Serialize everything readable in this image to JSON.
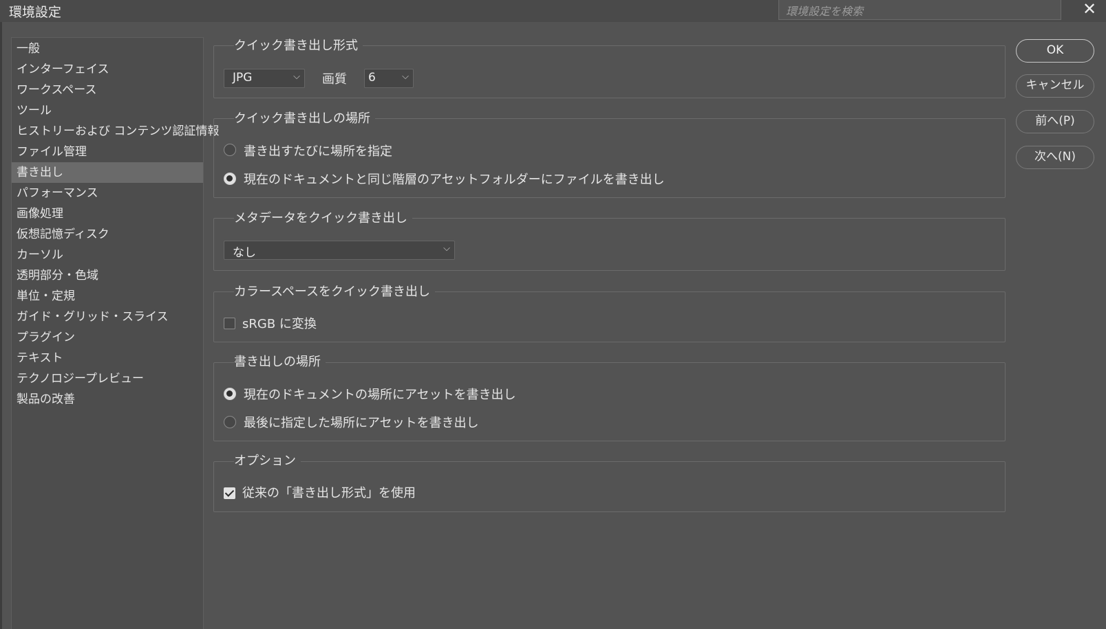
{
  "window": {
    "title": "環境設定",
    "close_glyph": "✕"
  },
  "search": {
    "placeholder": "環境設定を検索"
  },
  "sidebar": {
    "items": [
      {
        "label": "一般"
      },
      {
        "label": "インターフェイス"
      },
      {
        "label": "ワークスペース"
      },
      {
        "label": "ツール"
      },
      {
        "label": "ヒストリーおよび コンテンツ認証情報"
      },
      {
        "label": "ファイル管理"
      },
      {
        "label": "書き出し",
        "active": true
      },
      {
        "label": "パフォーマンス"
      },
      {
        "label": "画像処理"
      },
      {
        "label": "仮想記憶ディスク"
      },
      {
        "label": "カーソル"
      },
      {
        "label": "透明部分・色域"
      },
      {
        "label": "単位・定規"
      },
      {
        "label": "ガイド・グリッド・スライス"
      },
      {
        "label": "プラグイン"
      },
      {
        "label": "テキスト"
      },
      {
        "label": "テクノロジープレビュー"
      },
      {
        "label": "製品の改善"
      }
    ]
  },
  "quick_export_format": {
    "title": "クイック書き出し形式",
    "format_value": "JPG",
    "quality_label": "画質",
    "quality_value": "6"
  },
  "quick_export_location": {
    "title": "クイック書き出しの場所",
    "options": [
      {
        "label": "書き出すたびに場所を指定",
        "selected": false
      },
      {
        "label": "現在のドキュメントと同じ階層のアセットフォルダーにファイルを書き出し",
        "selected": true
      }
    ]
  },
  "quick_export_metadata": {
    "title": "メタデータをクイック書き出し",
    "value": "なし"
  },
  "quick_export_colorspace": {
    "title": "カラースペースをクイック書き出し",
    "checkbox_label": "sRGB に変換",
    "checked": false
  },
  "export_location": {
    "title": "書き出しの場所",
    "options": [
      {
        "label": "現在のドキュメントの場所にアセットを書き出し",
        "selected": true
      },
      {
        "label": "最後に指定した場所にアセットを書き出し",
        "selected": false
      }
    ]
  },
  "options": {
    "title": "オプション",
    "checkbox_label": "従来の「書き出し形式」を使用",
    "checked": true
  },
  "buttons": {
    "ok": "OK",
    "cancel": "キャンセル",
    "prev": "前へ(P)",
    "next": "次へ(N)"
  },
  "colors": {
    "background": "#535353",
    "panel": "#4d4d4d",
    "selected_item": "#6a6a6a"
  }
}
